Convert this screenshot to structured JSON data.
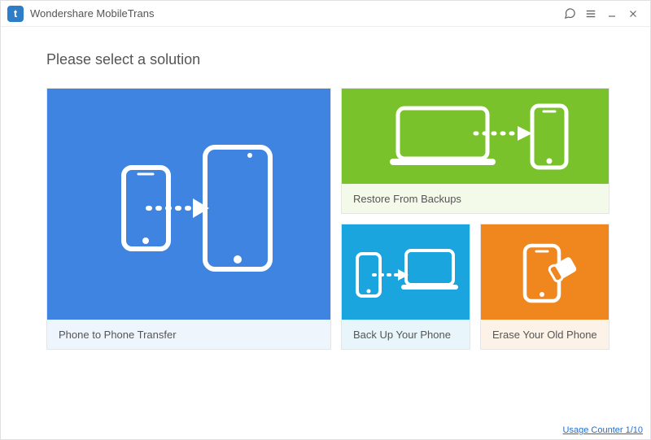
{
  "app": {
    "title": "Wondershare MobileTrans",
    "logo_letter": "t"
  },
  "heading": "Please select a solution",
  "tiles": {
    "transfer": {
      "label": "Phone to Phone Transfer"
    },
    "restore": {
      "label": "Restore From Backups"
    },
    "backup": {
      "label": "Back Up Your Phone"
    },
    "erase": {
      "label": "Erase Your Old Phone"
    }
  },
  "footer": {
    "usage_counter": "Usage Counter 1/10"
  },
  "colors": {
    "transfer": "#3e84e0",
    "restore": "#7ac22c",
    "backup": "#1aa5de",
    "erase": "#f0861e"
  }
}
